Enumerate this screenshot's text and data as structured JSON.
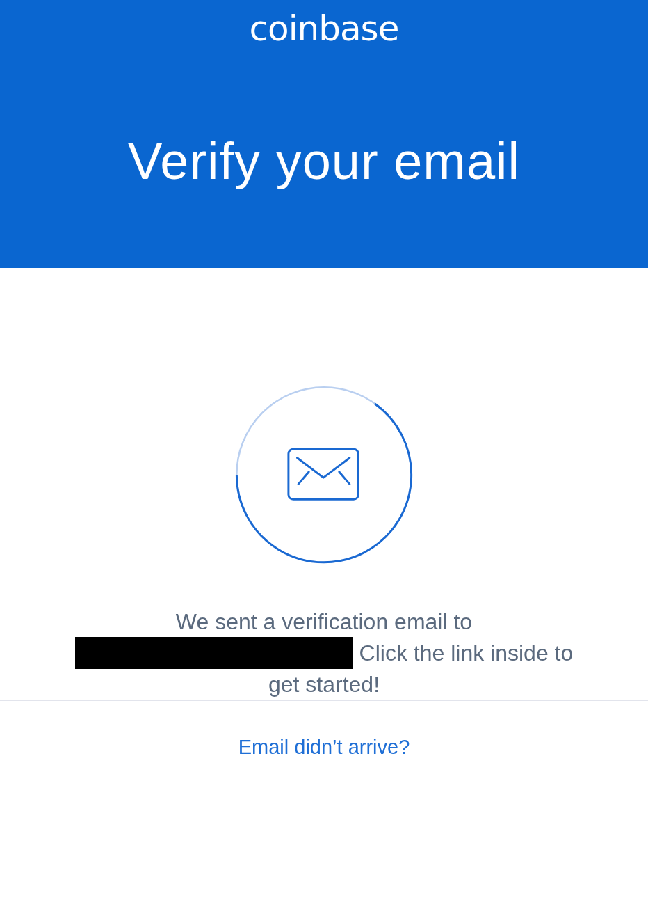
{
  "header": {
    "logo": "coinbase",
    "title": "Verify your email"
  },
  "message": {
    "text_before": "We sent a verification email to",
    "redacted": true,
    "text_after": "Click the link inside to get started!"
  },
  "footer": {
    "link": "Email didn’t arrive?"
  }
}
